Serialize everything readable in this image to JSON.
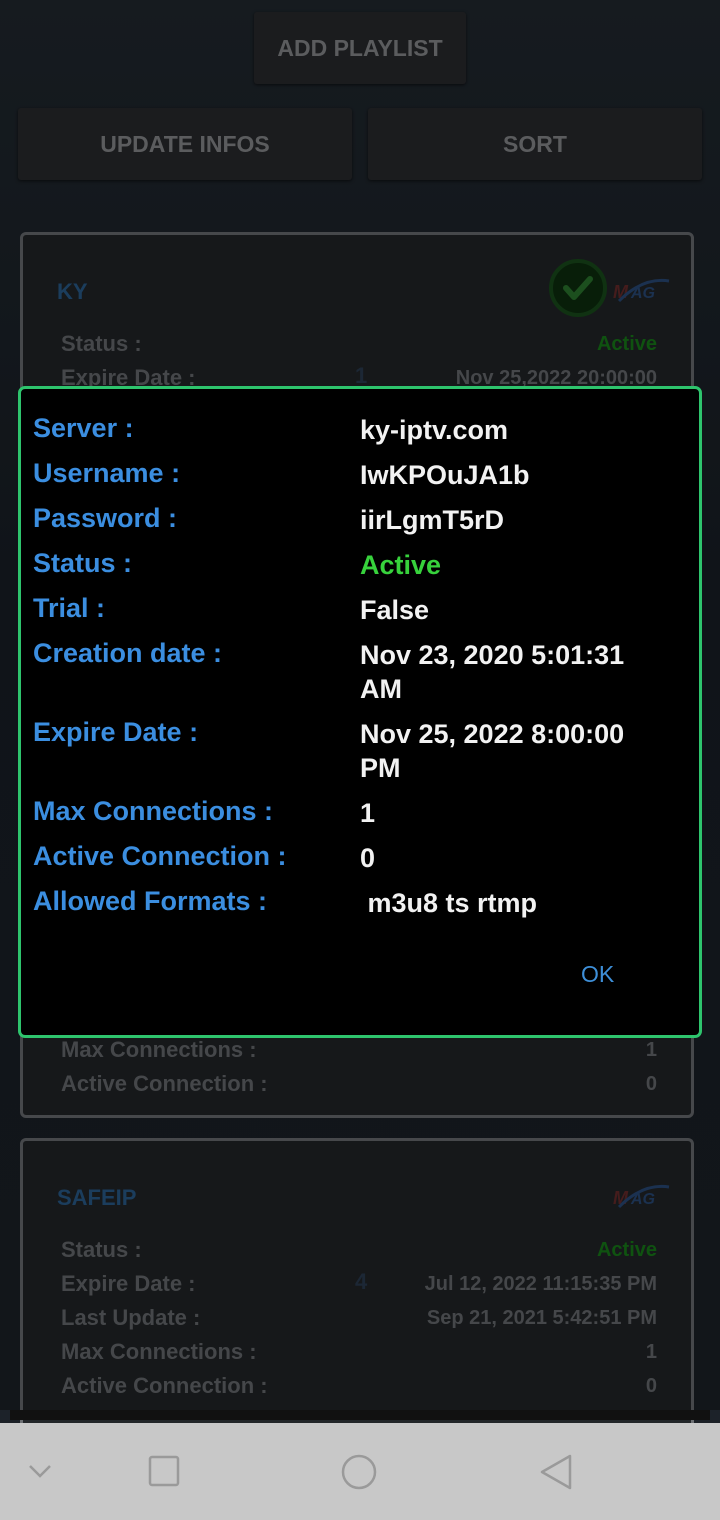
{
  "toolbar": {
    "add_playlist": "ADD PLAYLIST",
    "update_infos": "UPDATE INFOS",
    "sort": "SORT"
  },
  "cards": [
    {
      "name": "KY",
      "logo_icon": "mag-logo-icon",
      "selected_icon": "check-circle-icon",
      "rows": [
        {
          "label": "Status :",
          "value": "Active",
          "active": true
        },
        {
          "label": "Expire Date :",
          "value": "Nov 25,2022 20:00:00"
        }
      ],
      "hidden_index": "1",
      "bottom_rows": [
        {
          "label": "Max Connections :",
          "value": "1"
        },
        {
          "label": "Active Connection :",
          "value": "0"
        }
      ]
    },
    {
      "name": "SAFEIP",
      "logo_icon": "mag-logo-icon",
      "index": "4",
      "rows": [
        {
          "label": "Status :",
          "value": "Active",
          "active": true
        },
        {
          "label": "Expire Date :",
          "value": "Jul 12, 2022 11:15:35 PM"
        },
        {
          "label": "Last Update :",
          "value": "Sep 21, 2021 5:42:51 PM"
        },
        {
          "label": "Max Connections :",
          "value": "1"
        },
        {
          "label": "Active Connection :",
          "value": "0"
        }
      ]
    }
  ],
  "dialog": {
    "rows": [
      {
        "label": "Server :",
        "value": "ky-iptv.com"
      },
      {
        "label": "Username :",
        "value": "IwKPOuJA1b"
      },
      {
        "label": "Password :",
        "value": "iirLgmT5rD"
      },
      {
        "label": "Status :",
        "value": "Active"
      },
      {
        "label": "Trial :",
        "value": "False"
      },
      {
        "label": "Creation date :",
        "value": "Nov 23, 2020 5:01:31 AM"
      },
      {
        "label": "Expire Date :",
        "value": "Nov 25, 2022 8:00:00 PM"
      },
      {
        "label": "Max Connections :",
        "value": "1"
      },
      {
        "label": "Active Connection :",
        "value": "0"
      },
      {
        "label": "Allowed Formats :",
        "value": " m3u8 ts rtmp"
      }
    ],
    "ok": "OK"
  },
  "colors": {
    "accent_border": "#2ec46d",
    "label_blue": "#3b8ee0",
    "active_green": "#37d23c"
  },
  "navbar": {
    "icons": [
      "chevron-down-icon",
      "recent-apps-icon",
      "home-icon",
      "back-icon"
    ]
  }
}
